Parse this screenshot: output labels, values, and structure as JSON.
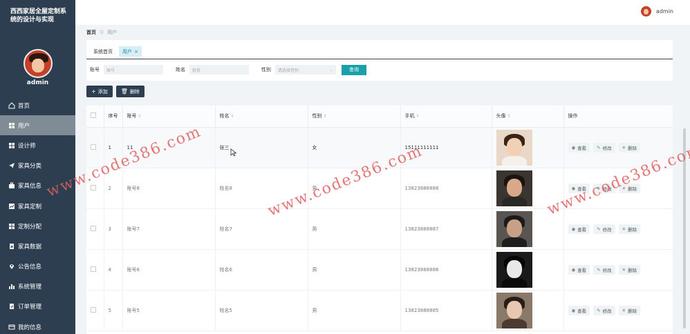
{
  "sidebar": {
    "title": "西西家居全屋定制系统的设计与实现",
    "username": "admin",
    "items": [
      {
        "label": "首页",
        "icon": "home-icon"
      },
      {
        "label": "用户",
        "icon": "grid-icon"
      },
      {
        "label": "设计师",
        "icon": "grid-icon"
      },
      {
        "label": "家具分类",
        "icon": "send-icon"
      },
      {
        "label": "家具信息",
        "icon": "briefcase-icon"
      },
      {
        "label": "家具定制",
        "icon": "chart-icon"
      },
      {
        "label": "定制分配",
        "icon": "grid-icon"
      },
      {
        "label": "家具数据",
        "icon": "clipboard-icon"
      },
      {
        "label": "公告信息",
        "icon": "pin-icon"
      },
      {
        "label": "系统管理",
        "icon": "bar-chart-icon"
      },
      {
        "label": "订单管理",
        "icon": "clipboard-icon"
      },
      {
        "label": "我的信息",
        "icon": "card-icon"
      }
    ]
  },
  "topbar": {
    "username": "admin"
  },
  "breadcrumb": {
    "home": "首页",
    "current": "用户"
  },
  "tabs": [
    {
      "label": "系统首页"
    },
    {
      "label": "用户",
      "close": "×"
    }
  ],
  "search": {
    "account_label": "账号",
    "account_placeholder": "账号",
    "name_label": "姓名",
    "name_placeholder": "姓名",
    "gender_label": "性别",
    "gender_placeholder": "请选择性别",
    "query_button": "查询"
  },
  "actions": {
    "add": "添加",
    "delete": "删除"
  },
  "table": {
    "headers": {
      "index": "序号",
      "account": "账号",
      "name": "姓名",
      "gender": "性别",
      "phone": "手机",
      "avatar": "头像",
      "ops": "操作"
    },
    "ops": {
      "view": "查看",
      "edit": "修改",
      "delete": "删除"
    },
    "rows": [
      {
        "index": "1",
        "account": "11",
        "name": "张三",
        "gender": "女",
        "phone": "15111111111"
      },
      {
        "index": "2",
        "account": "账号8",
        "name": "姓名8",
        "gender": "男",
        "phone": "13823888888"
      },
      {
        "index": "3",
        "account": "账号7",
        "name": "姓名7",
        "gender": "男",
        "phone": "13823888887"
      },
      {
        "index": "4",
        "account": "账号6",
        "name": "姓名6",
        "gender": "男",
        "phone": "13823888886"
      },
      {
        "index": "5",
        "account": "账号5",
        "name": "姓名5",
        "gender": "男",
        "phone": "13823888885"
      }
    ]
  },
  "watermark": "www.code386.com",
  "colors": {
    "sidebar": "#2c3e50",
    "accent": "#1aa0a8",
    "watermark": "#e06060"
  }
}
